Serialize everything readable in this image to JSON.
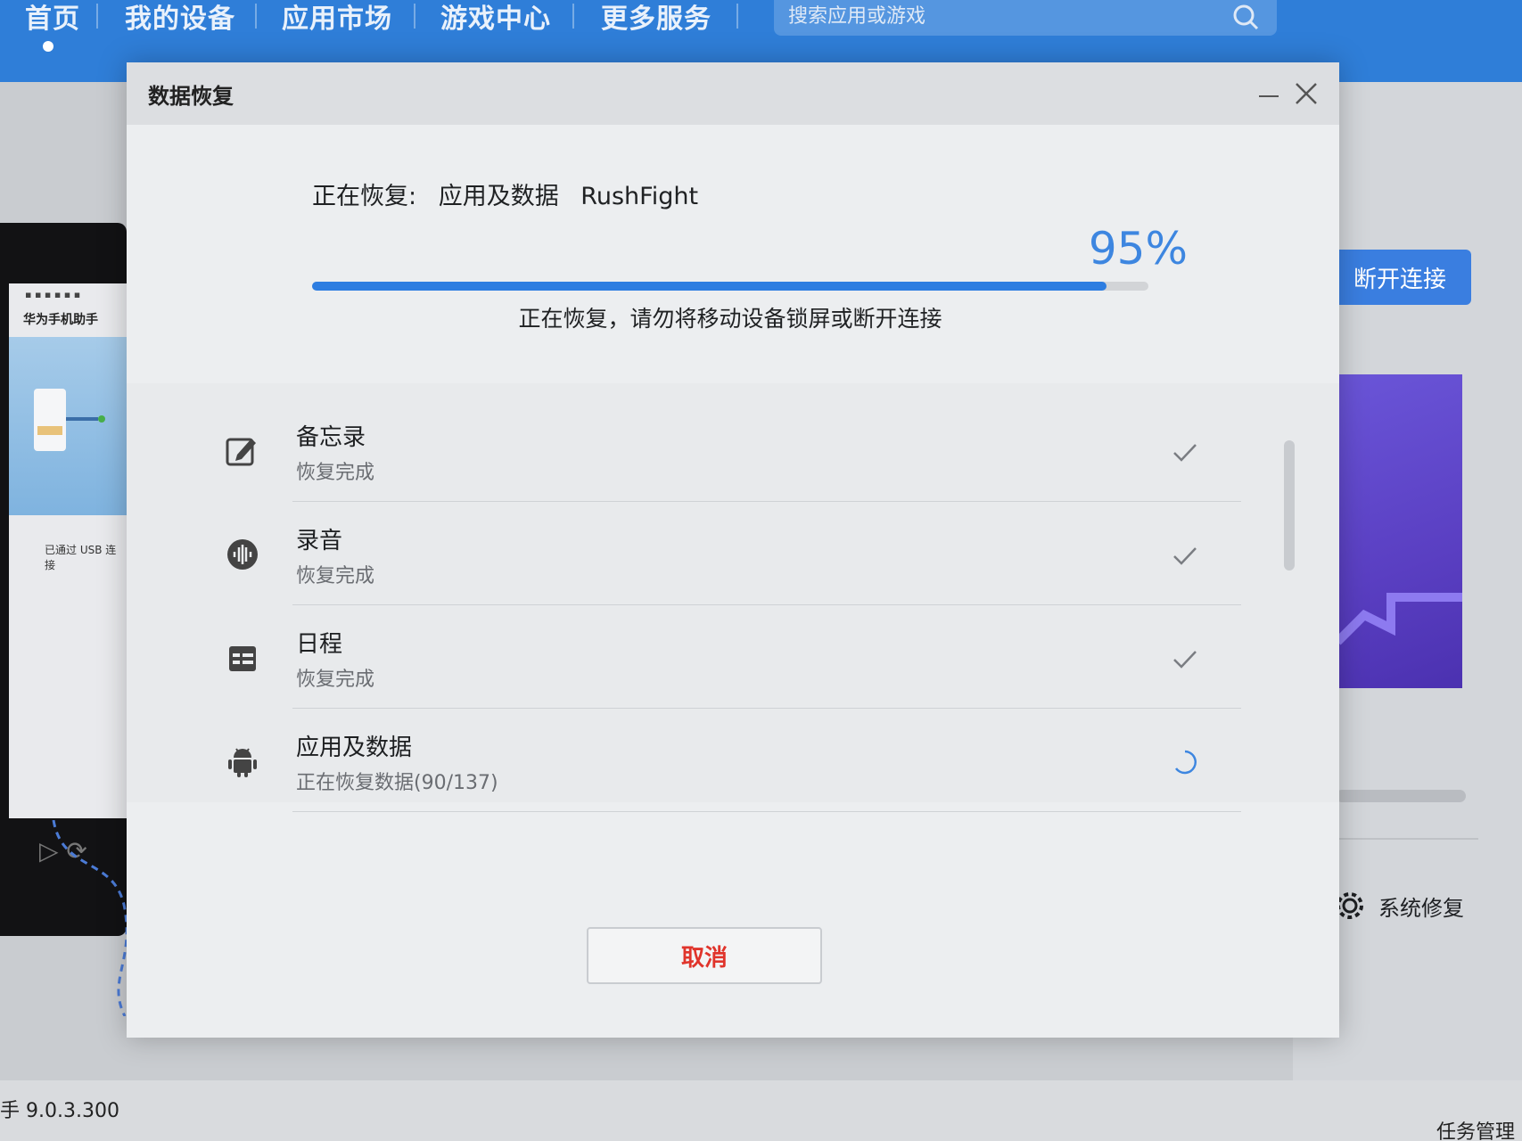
{
  "app": {
    "nav": [
      "首页",
      "我的设备",
      "应用市场",
      "游戏中心",
      "更多服务"
    ],
    "search_placeholder": "搜索应用或游戏",
    "disconnect_label": "断开连接",
    "system_repair_label": "系统修复",
    "version_text": "手 9.0.3.300",
    "task_manager_label": "任务管理",
    "phone_title": "华为手机助手",
    "phone_usb_note": "已通过 USB 连接",
    "accent_color": "#2f7ed8"
  },
  "dialog": {
    "title": "数据恢复",
    "status_prefix": "正在恢复:",
    "status_item": "应用及数据",
    "status_app": "RushFight",
    "percent_text": "95%",
    "progress": 0.95,
    "warning": "正在恢复，请勿将移动设备锁屏或断开连接",
    "cancel_label": "取消",
    "items": [
      {
        "title": "备忘录",
        "subtitle": "恢复完成",
        "icon": "note-edit-icon",
        "state": "done"
      },
      {
        "title": "录音",
        "subtitle": "恢复完成",
        "icon": "sound-wave-icon",
        "state": "done"
      },
      {
        "title": "日程",
        "subtitle": "恢复完成",
        "icon": "calendar-icon",
        "state": "done"
      },
      {
        "title": "应用及数据",
        "subtitle": "正在恢复数据(90/137)",
        "icon": "android-icon",
        "state": "loading"
      }
    ]
  }
}
